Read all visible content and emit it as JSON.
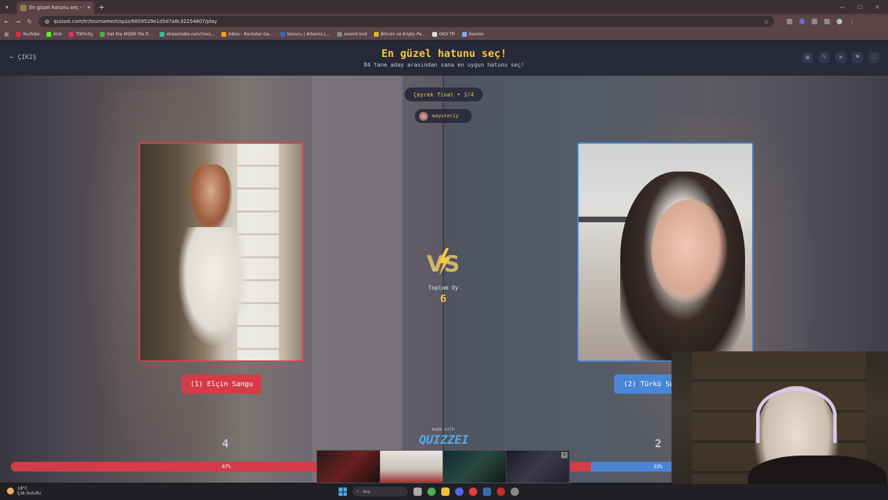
{
  "browser": {
    "tab_title": "En güzel hatunu seç - Tier List",
    "url": "quizzei.com/tr/tournament/quiz/6859529e1d5d7a8c32254807/play",
    "bookmarks": [
      {
        "label": "YouTube",
        "color": "#e03030"
      },
      {
        "label": "Kick",
        "color": "#53fc18"
      },
      {
        "label": "TikFinity",
        "color": "#e0306a"
      },
      {
        "label": "Get the MSDR File fr...",
        "color": "#4caf50"
      },
      {
        "label": "streamlabs.com/?ovs...",
        "color": "#30c0a0"
      },
      {
        "label": "Inbox - Rockstar Ga...",
        "color": "#f0a020"
      },
      {
        "label": "Sonucu | Artemis L...",
        "color": "#4060c0"
      },
      {
        "label": "onemli kod",
        "color": "#888888"
      },
      {
        "label": "Bitcoin ve Kripto Pa...",
        "color": "#f0b020"
      },
      {
        "label": "OKX TR",
        "color": "#dddddd"
      },
      {
        "label": "Gemini",
        "color": "#8aa8f0"
      }
    ]
  },
  "header": {
    "exit_label": "ÇIKIŞ",
    "title": "En güzel hatunu seç!",
    "subtitle": "84 tane aday arasından sana en uygun hatunu seç!",
    "icons": [
      "eye-icon",
      "edit-icon",
      "share-icon",
      "flag-icon",
      "fullscreen-icon"
    ]
  },
  "match": {
    "round": "Çeyrek final • 3/4",
    "username": "maysteriy",
    "total_label": "Toplam Oy",
    "total_votes": "6",
    "left": {
      "label": "(1) Elçin Sangu",
      "votes": "4",
      "percent_label": "67%",
      "percent": 0.67,
      "color": "#d63b48"
    },
    "right": {
      "label": "(2) Türkü Su",
      "votes": "2",
      "percent_label": "33%",
      "percent": 0.33,
      "color": "#4a86d6"
    },
    "made_with": "made with",
    "brand": "QUIZZEI"
  },
  "taskbar": {
    "temperature": "18°C",
    "weather": "Çok bulutlu",
    "search_placeholder": "Ara"
  }
}
